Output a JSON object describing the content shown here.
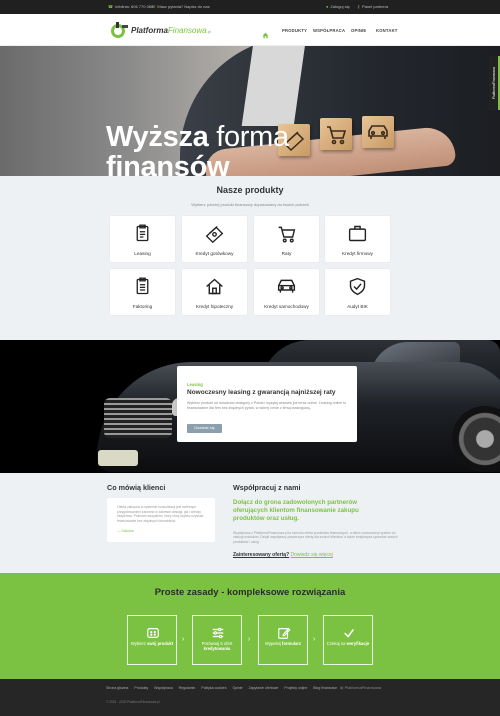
{
  "topbar": {
    "phone": "Infolinia: 606 770 086",
    "email": "Masz pytania? Napisz do nas",
    "login": "Zaloguj się",
    "partners": "Panel partnera"
  },
  "nav": {
    "logo_main": "Platforma",
    "logo_accent": "Finansowa",
    "logo_tld": ".pl",
    "items": [
      "PRODUKTY",
      "WSPÓŁPRACA",
      "OPINIE",
      "KONTAKT"
    ]
  },
  "hero": {
    "line1_bold": "Wyższa",
    "line1_thin": "forma",
    "line2": "finansów",
    "side_badge": "PlatformaFinansowa"
  },
  "products": {
    "title": "Nasze produkty",
    "subtitle": "Wybierz poniżej produkt finansowy dopasowany do twoich potrzeb",
    "items": [
      {
        "label": "Leasing",
        "icon": "clipboard-icon"
      },
      {
        "label": "Kredyt gotówkowy",
        "icon": "cash-icon"
      },
      {
        "label": "Raty",
        "icon": "cart-icon"
      },
      {
        "label": "Kredyt firmowy",
        "icon": "briefcase-icon"
      },
      {
        "label": "Faktoring",
        "icon": "invoice-icon"
      },
      {
        "label": "Kredyt hipoteczny",
        "icon": "house-icon"
      },
      {
        "label": "Kredyt samochodowy",
        "icon": "car-icon"
      },
      {
        "label": "Audyt BIK",
        "icon": "shield-icon"
      }
    ]
  },
  "promo": {
    "tag": "Leasing",
    "title": "Nowoczesny leasing z gwarancją najniższej raty",
    "desc": "Wybierz produkt od doradców dostępny z Polski i wysyłaj wniosek już teraz online. Leasing online to finansowanie dla firm bez zbędnych pytań, w dobrej cenie z firmą leasingową.",
    "button": "Dowiedz się"
  },
  "testimonials": {
    "title": "Co mówią klienci",
    "quote": "Oferta zakupów w systemie konsolidacji jest świetnym przygotowaniem zarówno w zakresie obsługi, jak i wiedzy ekspertów. Polecam wszystkim, który chcą szybko uzyskać finansowanie bez zbędnych formalności.",
    "author": "— Oskowa"
  },
  "cooperation": {
    "title": "Współpracuj z nami",
    "lead": "Dołącz do grona zadowolonych partnerów oferujących klientom finansowanie zakupu produktów oraz usług.",
    "text": "Współpraca z PlatformaFinansowa.pl to szeroka oferta produktów finansowych, a także nowoczesny system do obsługi wniosków. Dzięki współpracy poszerzysz ofertę dla swoich klientów, a także zwiększysz sprzedaż swoich produktów i usług.",
    "cta_question": "Zainteresowany ofertą?",
    "cta_link": "Dowiedz się więcej"
  },
  "rules": {
    "title": "Proste zasady - kompleksowe rozwiązania",
    "steps": [
      {
        "pre": "Wybierz ",
        "bold": "swój produkt",
        "icon": "grid-icon"
      },
      {
        "pre": "Porównaj 5 ofert ",
        "bold": "kredytowania",
        "icon": "sliders-icon"
      },
      {
        "pre": "Wypełnij ",
        "bold": "formularz",
        "icon": "edit-icon"
      },
      {
        "pre": "Czekaj na ",
        "bold": "weryfikacje",
        "icon": "check-icon"
      }
    ]
  },
  "footer": {
    "links": [
      "Strona główna",
      "Produkty",
      "Współpraca",
      "Regulamin",
      "Polityka cookies",
      "Opinie",
      "Zapytanie ofertowe",
      "Projekty unijne",
      "Blog finansowe"
    ],
    "copyright": "© 2015 - 2020 PlatformaFinansowa.pl",
    "brand": "PlatformaFinansowa"
  },
  "colors": {
    "accent": "#7cc242",
    "dark": "#262626"
  }
}
